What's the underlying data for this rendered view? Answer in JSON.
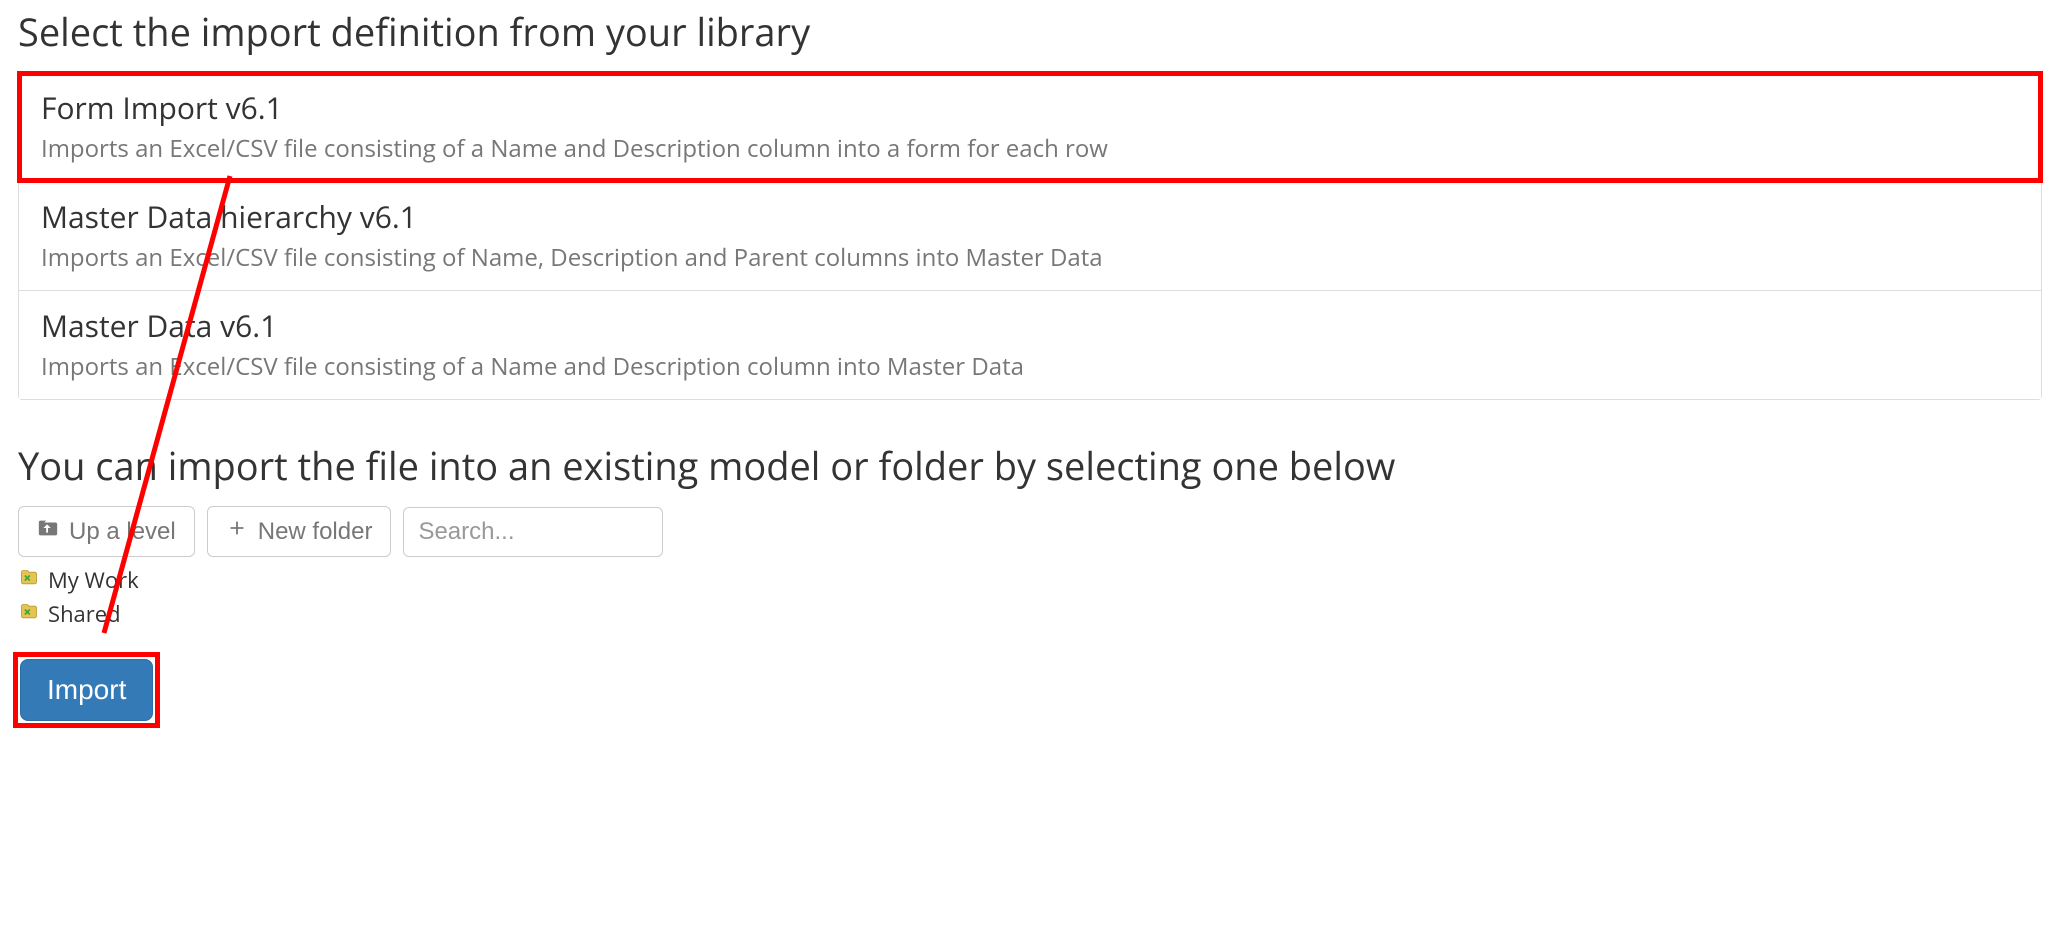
{
  "headings": {
    "select_definition": "Select the import definition from your library",
    "import_location": "You can import the file into an existing model or folder by selecting one below"
  },
  "definitions": [
    {
      "title": "Form Import v6.1",
      "description": "Imports an Excel/CSV file consisting of a Name and Description column into a form for each row",
      "selected": true
    },
    {
      "title": "Master Data hierarchy v6.1",
      "description": "Imports an Excel/CSV file consisting of Name, Description and Parent columns into Master Data",
      "selected": false
    },
    {
      "title": "Master Data v6.1",
      "description": "Imports an Excel/CSV file consisting of a Name and Description column into Master Data",
      "selected": false
    }
  ],
  "toolbar": {
    "up_level_label": "Up a level",
    "new_folder_label": "New folder",
    "search_placeholder": "Search..."
  },
  "folders": [
    {
      "label": "My Work"
    },
    {
      "label": "Shared"
    }
  ],
  "actions": {
    "import_label": "Import"
  }
}
